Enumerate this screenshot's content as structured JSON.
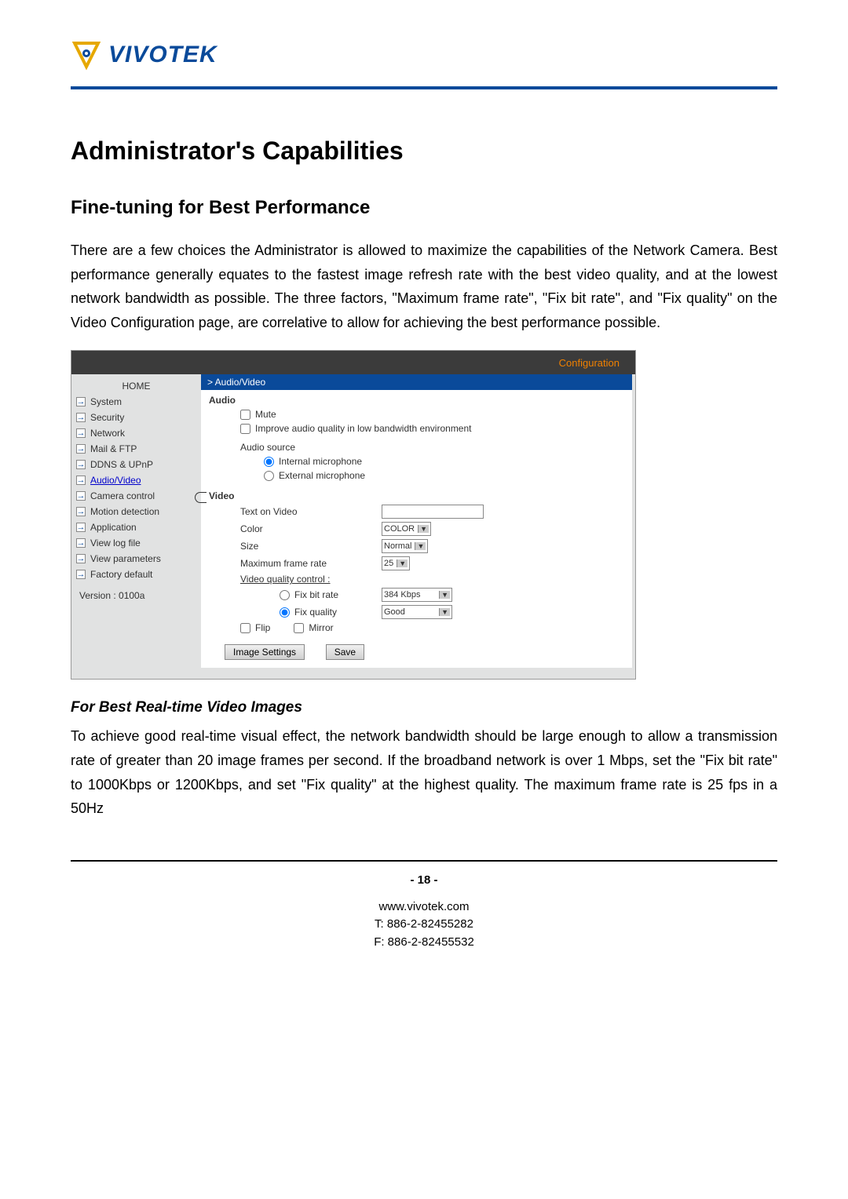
{
  "logo": {
    "brand": "VIVOTEK"
  },
  "h1": "Administrator's Capabilities",
  "h2": "Fine-tuning for Best Performance",
  "para1": "There are a few choices the Administrator is allowed to maximize the capabilities of the Network Camera.  Best performance generally equates to the fastest image refresh rate with the best video quality, and at the lowest network bandwidth as possible. The three factors, \"Maximum frame rate\", \"Fix bit rate\", and \"Fix quality\" on the Video Configuration page, are correlative to allow for achieving the best performance possible.",
  "screenshot": {
    "header": "Configuration",
    "nav": {
      "home": "HOME",
      "items": [
        "System",
        "Security",
        "Network",
        "Mail & FTP",
        "DDNS & UPnP",
        "Audio/Video",
        "Camera control",
        "Motion detection",
        "Application",
        "View log file",
        "View parameters",
        "Factory default"
      ],
      "active_index": 5,
      "version": "Version : 0100a"
    },
    "content": {
      "breadcrumb": "> Audio/Video",
      "audio": {
        "title": "Audio",
        "mute": "Mute",
        "improve": "Improve audio quality in low bandwidth environment",
        "source_label": "Audio source",
        "internal": "Internal microphone",
        "external": "External microphone"
      },
      "video": {
        "title": "Video",
        "text_on_video": "Text on Video",
        "color_label": "Color",
        "color_value": "COLOR",
        "size_label": "Size",
        "size_value": "Normal",
        "mfr_label": "Maximum frame rate",
        "mfr_value": "25",
        "vqc_label": "Video quality control :",
        "fix_bit_rate": "Fix bit rate",
        "fix_bit_rate_value": "384 Kbps",
        "fix_quality": "Fix quality",
        "fix_quality_value": "Good",
        "flip": "Flip",
        "mirror": "Mirror"
      },
      "buttons": {
        "image_settings": "Image Settings",
        "save": "Save"
      }
    }
  },
  "h3": "For Best Real-time Video Images",
  "para2": "To achieve good real-time visual effect, the network bandwidth should be large enough to allow a transmission rate of greater than 20 image frames per second.  If the broadband network is over 1 Mbps, set the \"Fix bit rate\" to 1000Kbps or 1200Kbps, and set \"Fix quality\" at the highest quality. The maximum frame rate is 25 fps in a 50Hz",
  "footer": {
    "page": "- 18 -",
    "url": "www.vivotek.com",
    "tel": "T: 886-2-82455282",
    "fax": "F: 886-2-82455532"
  }
}
